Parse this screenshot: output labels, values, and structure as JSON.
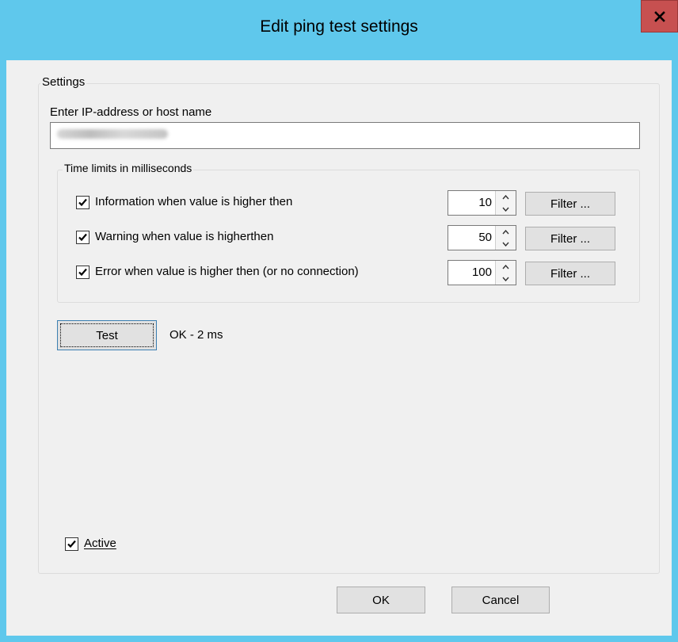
{
  "window": {
    "title": "Edit ping test settings"
  },
  "settings_group": {
    "label": "Settings",
    "host_label": "Enter IP-address or host name",
    "host_value": ""
  },
  "time_limits_group": {
    "label": "Time limits in milliseconds",
    "rows": [
      {
        "label": "Information when value is higher then",
        "checked": true,
        "value": "10",
        "filter_label": "Filter ..."
      },
      {
        "label": "Warning when value is higherthen",
        "checked": true,
        "value": "50",
        "filter_label": "Filter ..."
      },
      {
        "label": "Error when value is higher then (or no connection)",
        "checked": true,
        "value": "100",
        "filter_label": "Filter ..."
      }
    ]
  },
  "test": {
    "button_label": "Test",
    "result": "OK - 2 ms"
  },
  "active": {
    "label": "Active",
    "checked": true
  },
  "footer": {
    "ok_label": "OK",
    "cancel_label": "Cancel"
  },
  "colors": {
    "title_bar": "#5fc8ec",
    "close_button": "#c75050",
    "dialog_bg": "#f0f0f0"
  }
}
